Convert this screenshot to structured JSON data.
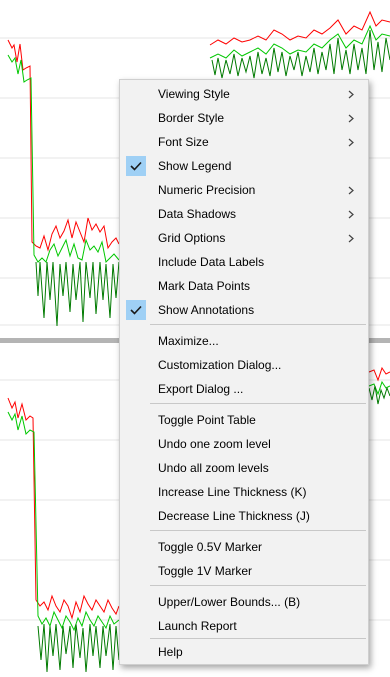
{
  "menu": {
    "items": [
      {
        "label": "Viewing Style",
        "submenu": true,
        "checked": false
      },
      {
        "label": "Border Style",
        "submenu": true,
        "checked": false
      },
      {
        "label": "Font Size",
        "submenu": true,
        "checked": false
      },
      {
        "label": "Show Legend",
        "submenu": false,
        "checked": true
      },
      {
        "label": "Numeric Precision",
        "submenu": true,
        "checked": false
      },
      {
        "label": "Data Shadows",
        "submenu": true,
        "checked": false
      },
      {
        "label": "Grid Options",
        "submenu": true,
        "checked": false
      },
      {
        "label": "Include Data Labels",
        "submenu": false,
        "checked": false
      },
      {
        "label": "Mark Data Points",
        "submenu": false,
        "checked": false
      },
      {
        "label": "Show Annotations",
        "submenu": false,
        "checked": true
      },
      {
        "label": "Maximize...",
        "submenu": false,
        "checked": false
      },
      {
        "label": "Customization Dialog...",
        "submenu": false,
        "checked": false
      },
      {
        "label": "Export Dialog ...",
        "submenu": false,
        "checked": false
      },
      {
        "label": "Toggle Point Table",
        "submenu": false,
        "checked": false
      },
      {
        "label": "Undo one zoom level",
        "submenu": false,
        "checked": false
      },
      {
        "label": "Undo all zoom levels",
        "submenu": false,
        "checked": false
      },
      {
        "label": "Increase Line Thickness (K)",
        "submenu": false,
        "checked": false
      },
      {
        "label": "Decrease Line Thickness (J)",
        "submenu": false,
        "checked": false
      },
      {
        "label": "Toggle 0.5V Marker",
        "submenu": false,
        "checked": false
      },
      {
        "label": "Toggle 1V Marker",
        "submenu": false,
        "checked": false
      },
      {
        "label": "Upper/Lower Bounds... (B)",
        "submenu": false,
        "checked": false
      },
      {
        "label": "Launch Report",
        "submenu": false,
        "checked": false
      },
      {
        "label": "Help",
        "submenu": false,
        "checked": false
      }
    ]
  },
  "colors": {
    "upper_trace": "#ff0000",
    "lower_trace": "#00c800",
    "detail_trace": "#007a00",
    "check_highlight": "#9fd0f5",
    "menu_background": "#f2f2f2",
    "splitter": "#b4b4b4"
  },
  "icons": {
    "check": "check-icon",
    "submenu": "chevron-right-icon"
  }
}
